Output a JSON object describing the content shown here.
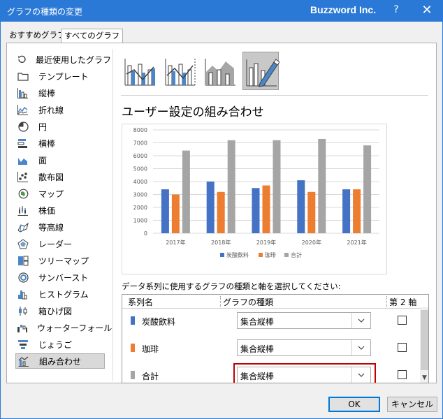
{
  "window": {
    "title": "グラフの種類の変更",
    "brand": "Buzzword Inc.",
    "help": "?",
    "close": "✕"
  },
  "tabs": [
    {
      "label": "おすすめグラフ"
    },
    {
      "label": "すべてのグラフ"
    }
  ],
  "sidebar": {
    "items": [
      {
        "label": "最近使用したグラフ",
        "icon": "recent-icon"
      },
      {
        "label": "テンプレート",
        "icon": "folder-icon"
      },
      {
        "label": "縦棒",
        "icon": "column-chart-icon"
      },
      {
        "label": "折れ線",
        "icon": "line-chart-icon"
      },
      {
        "label": "円",
        "icon": "pie-chart-icon"
      },
      {
        "label": "横棒",
        "icon": "bar-chart-icon"
      },
      {
        "label": "面",
        "icon": "area-chart-icon"
      },
      {
        "label": "散布図",
        "icon": "scatter-chart-icon"
      },
      {
        "label": "マップ",
        "icon": "map-chart-icon"
      },
      {
        "label": "株価",
        "icon": "stock-chart-icon"
      },
      {
        "label": "等高線",
        "icon": "surface-chart-icon"
      },
      {
        "label": "レーダー",
        "icon": "radar-chart-icon"
      },
      {
        "label": "ツリーマップ",
        "icon": "treemap-icon"
      },
      {
        "label": "サンバースト",
        "icon": "sunburst-icon"
      },
      {
        "label": "ヒストグラム",
        "icon": "histogram-icon"
      },
      {
        "label": "箱ひげ図",
        "icon": "box-whisker-icon"
      },
      {
        "label": "ウォーターフォール",
        "icon": "waterfall-icon"
      },
      {
        "label": "じょうご",
        "icon": "funnel-icon"
      },
      {
        "label": "組み合わせ",
        "icon": "combo-chart-icon",
        "selected": true
      }
    ]
  },
  "main": {
    "section_title": "ユーザー設定の組み合わせ",
    "instruction": "データ系列に使用するグラフの種類と軸を選択してください:",
    "table": {
      "headers": {
        "series": "系列名",
        "chart_type": "グラフの種類",
        "secondary_axis": "第 2 軸"
      },
      "rows": [
        {
          "name": "炭酸飲料",
          "type": "集合縦棒",
          "color": "#4472c4",
          "secondary": false
        },
        {
          "name": "珈琲",
          "type": "集合縦棒",
          "color": "#ed7d31",
          "secondary": false
        },
        {
          "name": "合計",
          "type": "集合縦棒",
          "color": "#a5a5a5",
          "secondary": false
        }
      ]
    }
  },
  "chart_data": {
    "type": "bar",
    "categories": [
      "2017年",
      "2018年",
      "2019年",
      "2020年",
      "2021年"
    ],
    "series": [
      {
        "name": "炭酸飲料",
        "values": [
          3400,
          4000,
          3500,
          4100,
          3400
        ],
        "color": "#4472c4"
      },
      {
        "name": "珈琲",
        "values": [
          3000,
          3200,
          3700,
          3200,
          3400
        ],
        "color": "#ed7d31"
      },
      {
        "name": "合計",
        "values": [
          6400,
          7200,
          7200,
          7300,
          6800
        ],
        "color": "#a5a5a5"
      }
    ],
    "y_ticks": [
      "0",
      "1000",
      "2000",
      "3000",
      "4000",
      "5000",
      "6000",
      "7000",
      "8000"
    ],
    "ylim": [
      0,
      8000
    ],
    "grid": true,
    "legend": "bottom"
  },
  "buttons": {
    "ok": "OK",
    "cancel": "キャンセル"
  }
}
